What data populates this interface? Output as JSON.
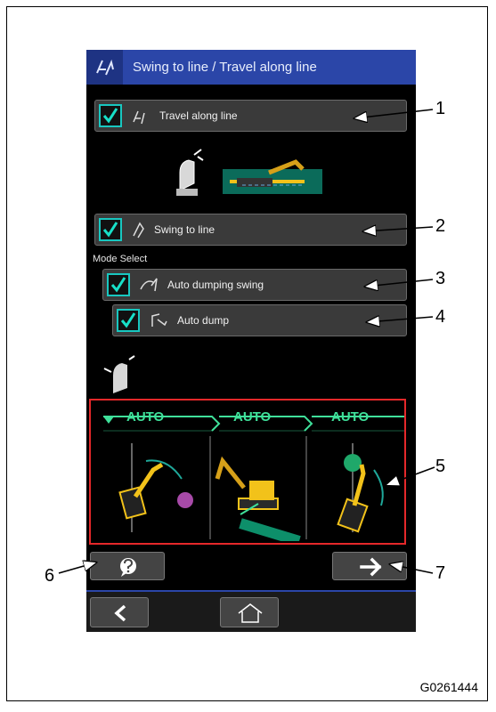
{
  "screen": {
    "title": "Swing to line / Travel along line",
    "title_icon": "travel-line-icon"
  },
  "options": [
    {
      "label": "Travel along line",
      "checked": true,
      "icon": "travel-line-icon"
    },
    {
      "label": "Swing to line",
      "checked": true,
      "icon": "swing-line-icon"
    },
    {
      "label": "Auto dumping swing",
      "checked": true,
      "icon": "auto-swing-icon"
    },
    {
      "label": "Auto dump",
      "checked": true,
      "icon": "auto-dump-icon"
    }
  ],
  "mode_select_label": "Mode Select",
  "sequence": {
    "steps": [
      "AUTO",
      "AUTO",
      "AUTO"
    ],
    "highlight_color": "#e5282a"
  },
  "buttons": {
    "help_icon": "question-icon",
    "next_icon": "arrow-right-icon",
    "back_icon": "chevron-left-icon",
    "home_icon": "home-icon"
  },
  "callouts": [
    "1",
    "2",
    "3",
    "4",
    "5",
    "6",
    "7"
  ],
  "figure_code": "G0261444",
  "colors": {
    "titlebar": "#2b46a8",
    "check": "#18c7c0",
    "auto_text": "#3fe09a"
  }
}
